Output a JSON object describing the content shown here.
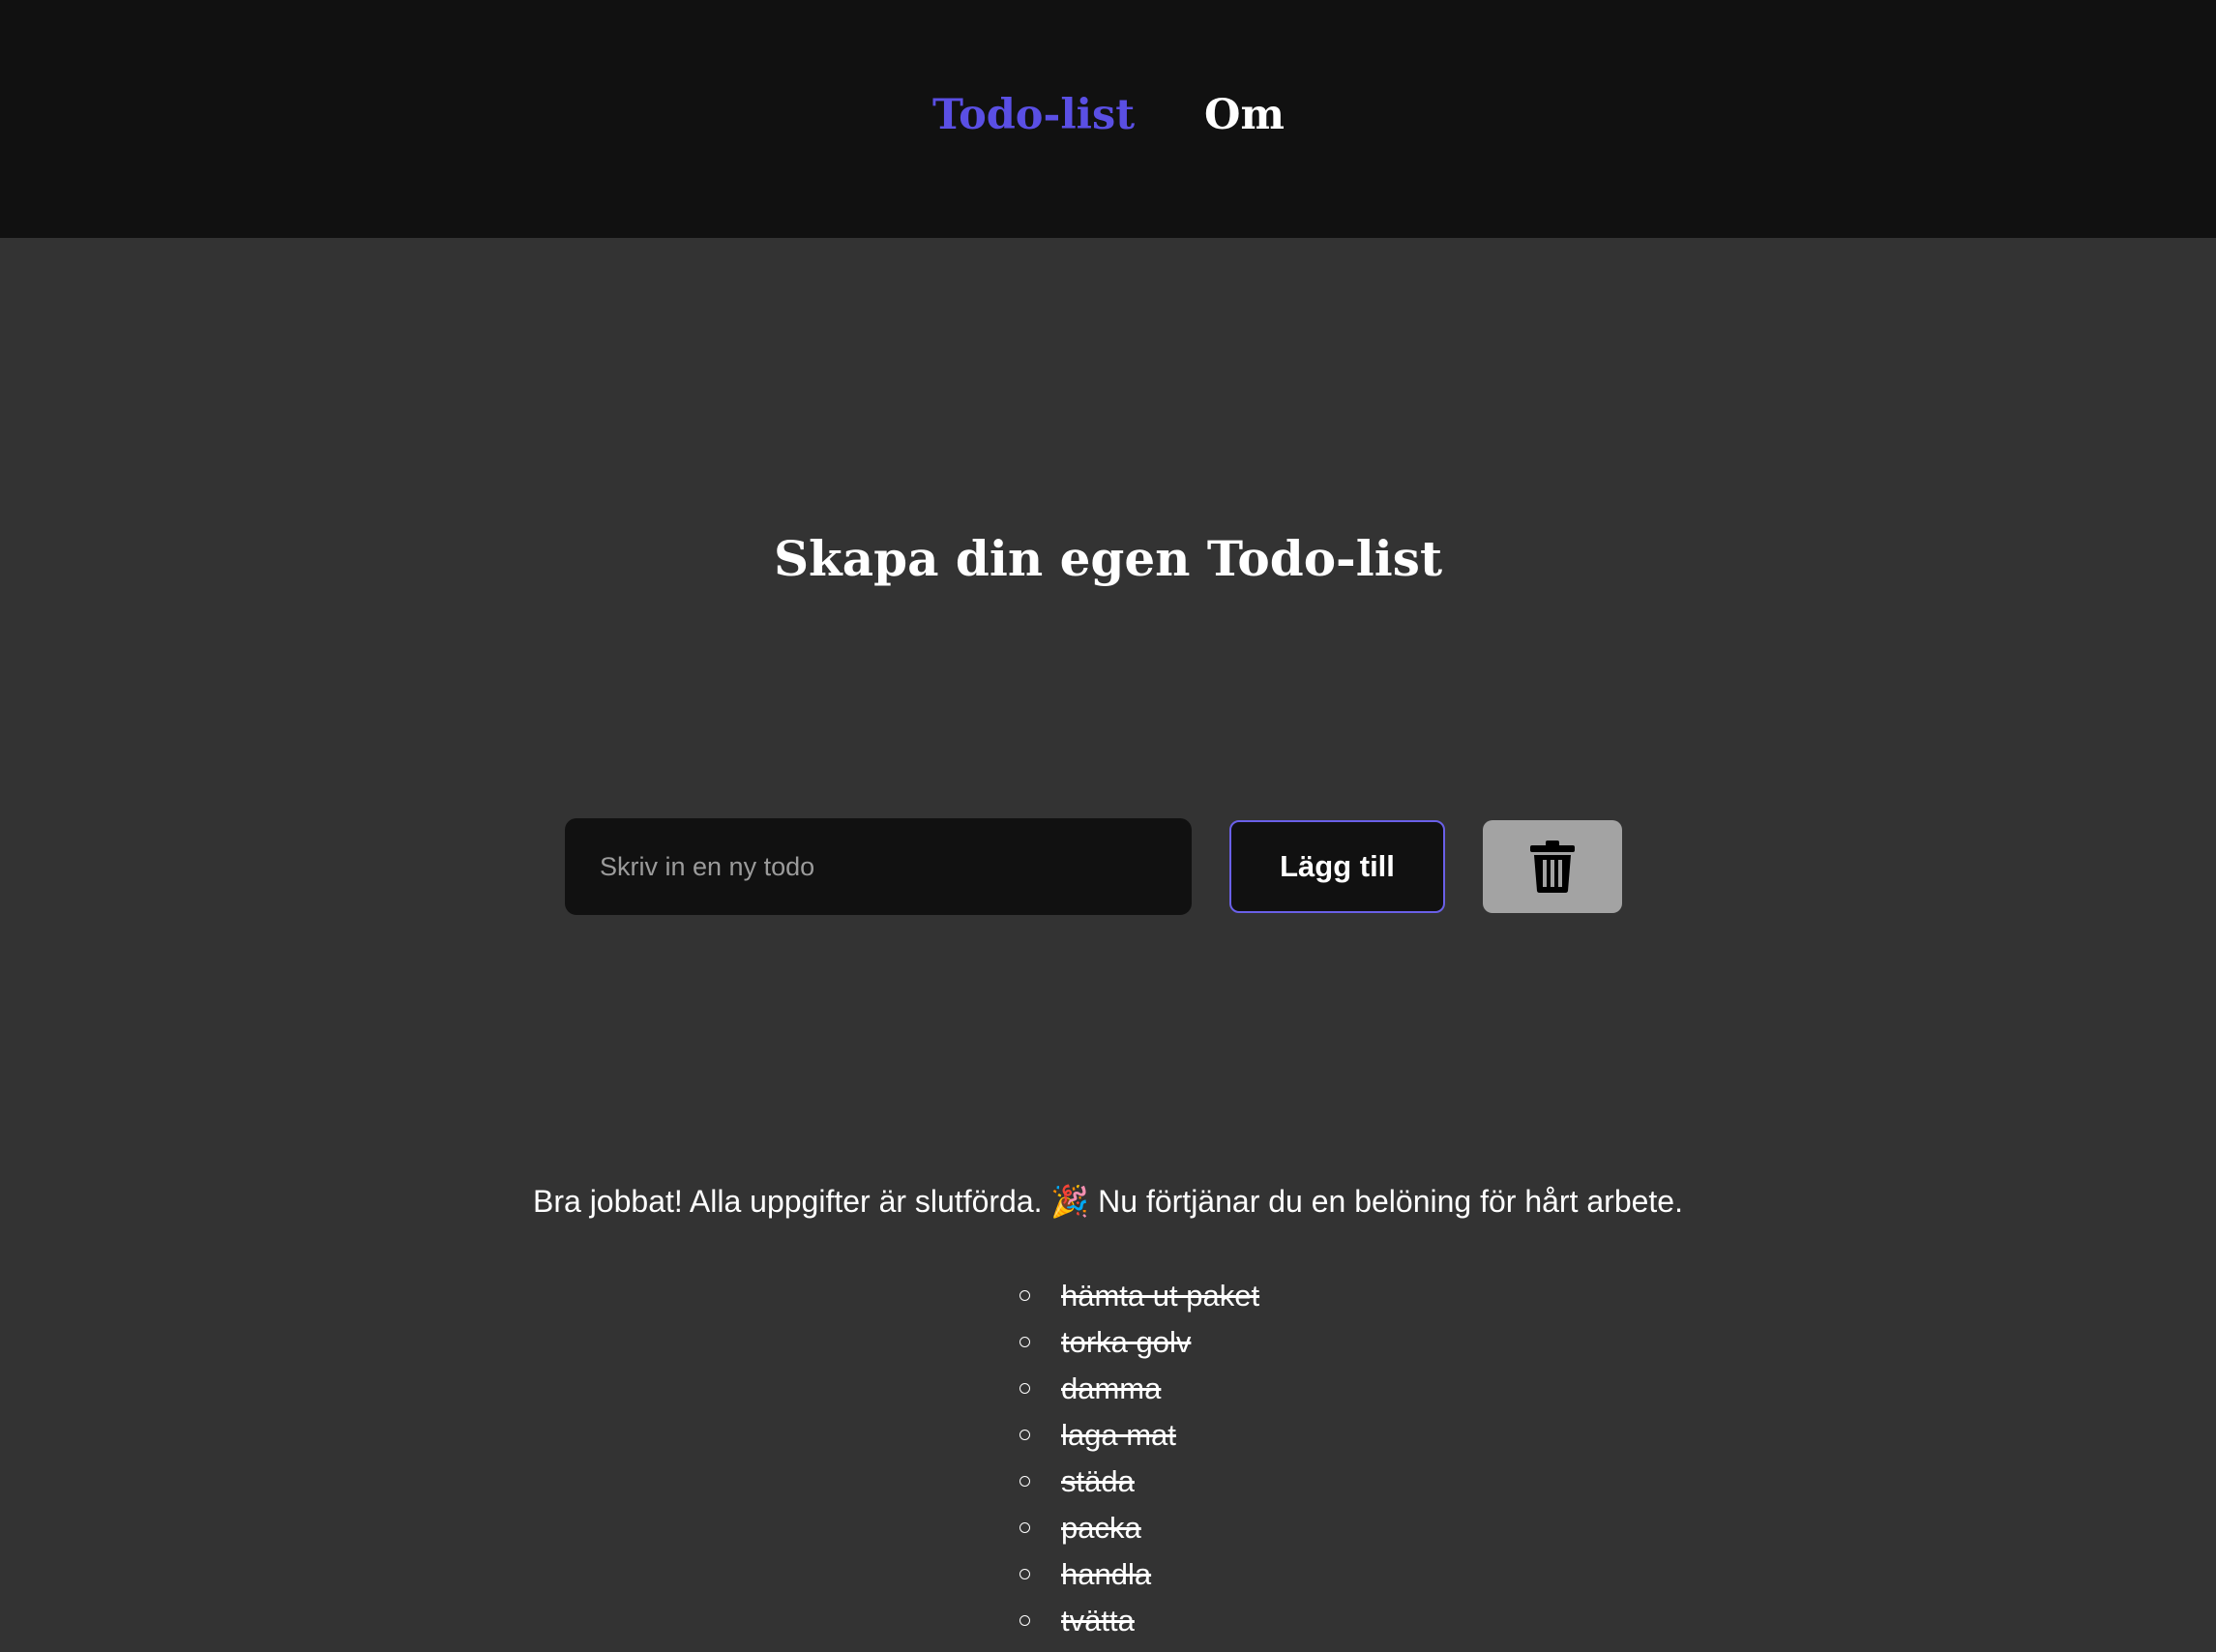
{
  "nav": {
    "links": [
      {
        "label": "Todo-list",
        "active": true
      },
      {
        "label": "Om",
        "active": false
      }
    ]
  },
  "main": {
    "title": "Skapa din egen Todo-list",
    "input_placeholder": "Skriv in en ny todo",
    "input_value": "",
    "add_button_label": "Lägg till",
    "delete_icon": "trash-icon",
    "status_message": "Bra jobbat! Alla uppgifter är slutförda. 🎉 Nu förtjänar du en belöning för hårt arbete."
  },
  "todos": [
    {
      "text": "hämta ut paket",
      "done": true
    },
    {
      "text": "torka golv",
      "done": true
    },
    {
      "text": "damma",
      "done": true
    },
    {
      "text": "laga mat",
      "done": true
    },
    {
      "text": "städa",
      "done": true
    },
    {
      "text": "packa",
      "done": true
    },
    {
      "text": "handla",
      "done": true
    },
    {
      "text": "tvätta",
      "done": true
    }
  ],
  "colors": {
    "accent": "#5a4fe4",
    "header_bg": "#111111",
    "page_bg": "#333333",
    "trash_button_bg": "#a3a3a3"
  }
}
